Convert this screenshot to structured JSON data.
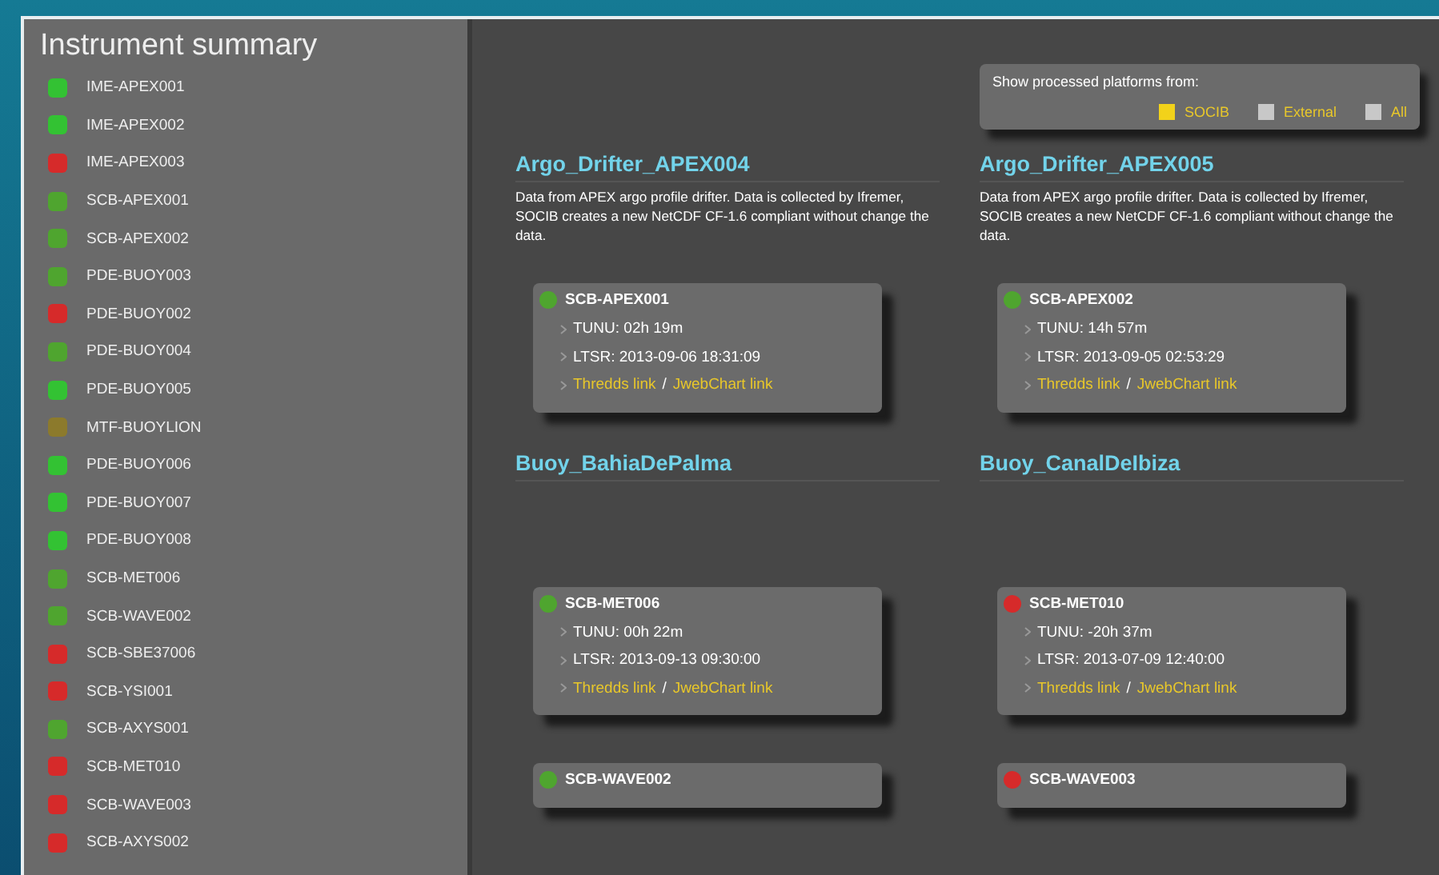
{
  "sidebar": {
    "title": "Instrument summary",
    "items": [
      {
        "name": "IME-APEX001",
        "color": "#33c233"
      },
      {
        "name": "IME-APEX002",
        "color": "#33c233"
      },
      {
        "name": "IME-APEX003",
        "color": "#d62a2a"
      },
      {
        "name": "SCB-APEX001",
        "color": "#4fa52f"
      },
      {
        "name": "SCB-APEX002",
        "color": "#4fa52f"
      },
      {
        "name": "PDE-BUOY003",
        "color": "#4fa52f"
      },
      {
        "name": "PDE-BUOY002",
        "color": "#d62a2a"
      },
      {
        "name": "PDE-BUOY004",
        "color": "#4fa52f"
      },
      {
        "name": "PDE-BUOY005",
        "color": "#33c233"
      },
      {
        "name": "MTF-BUOYLION",
        "color": "#8c7a2c"
      },
      {
        "name": "PDE-BUOY006",
        "color": "#33c233"
      },
      {
        "name": "PDE-BUOY007",
        "color": "#33c233"
      },
      {
        "name": "PDE-BUOY008",
        "color": "#33c233"
      },
      {
        "name": "SCB-MET006",
        "color": "#4fa52f"
      },
      {
        "name": "SCB-WAVE002",
        "color": "#4fa52f"
      },
      {
        "name": "SCB-SBE37006",
        "color": "#d62a2a"
      },
      {
        "name": "SCB-YSI001",
        "color": "#d62a2a"
      },
      {
        "name": "SCB-AXYS001",
        "color": "#4fa52f"
      },
      {
        "name": "SCB-MET010",
        "color": "#d62a2a"
      },
      {
        "name": "SCB-WAVE003",
        "color": "#d62a2a"
      },
      {
        "name": "SCB-AXYS002",
        "color": "#d62a2a"
      }
    ]
  },
  "filter": {
    "label": "Show processed platforms from:",
    "options": [
      {
        "label": "SOCIB",
        "checked": true
      },
      {
        "label": "External",
        "checked": false
      },
      {
        "label": "All",
        "checked": false
      }
    ]
  },
  "sections": [
    {
      "title": "Argo_Drifter_APEX004",
      "description": "Data from APEX argo profile drifter. Data is collected by Ifremer, SOCIB creates a new NetCDF CF-1.6 compliant without change the data.",
      "cards": [
        {
          "name": "SCB-APEX001",
          "color": "#4fa52f",
          "tunu": "TUNU: 02h 19m",
          "ltsr": "LTSR: 2013-09-06 18:31:09",
          "link_1": "Thredds link",
          "separator": "/",
          "link_2": "JwebChart link"
        }
      ]
    },
    {
      "title": "Argo_Drifter_APEX005",
      "description": "Data from APEX argo profile drifter. Data is collected by Ifremer, SOCIB creates a new NetCDF CF-1.6 compliant without change the data.",
      "cards": [
        {
          "name": "SCB-APEX002",
          "color": "#4fa52f",
          "tunu": "TUNU: 14h 57m",
          "ltsr": "LTSR: 2013-09-05 02:53:29",
          "link_1": "Thredds link",
          "separator": "/",
          "link_2": "JwebChart link"
        }
      ]
    },
    {
      "title": "Buoy_BahiaDePalma",
      "cards": [
        {
          "name": "SCB-MET006",
          "color": "#4fa52f",
          "tunu": "TUNU: 00h 22m",
          "ltsr": "LTSR: 2013-09-13 09:30:00",
          "link_1": "Thredds link",
          "separator": "/",
          "link_2": "JwebChart link"
        },
        {
          "name": "SCB-WAVE002",
          "color": "#4fa52f"
        }
      ]
    },
    {
      "title": "Buoy_CanalDeIbiza",
      "cards": [
        {
          "name": "SCB-MET010",
          "color": "#d62a2a",
          "tunu": "TUNU: -20h 37m",
          "ltsr": "LTSR: 2013-07-09 12:40:00",
          "link_1": "Thredds link",
          "separator": "/",
          "link_2": "JwebChart link"
        },
        {
          "name": "SCB-WAVE003",
          "color": "#d62a2a"
        }
      ]
    }
  ]
}
